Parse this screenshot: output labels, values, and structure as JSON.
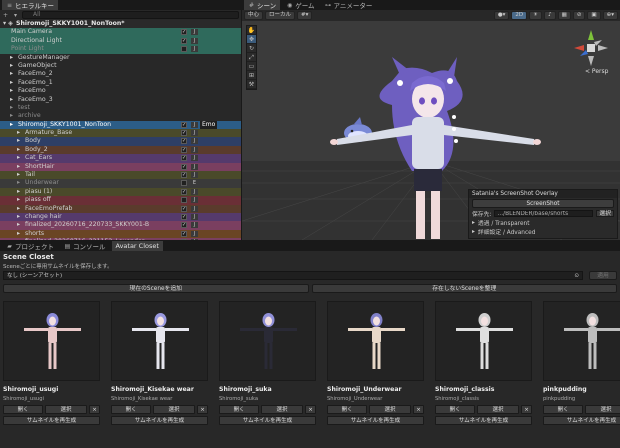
{
  "hierarchy": {
    "tab_label": "ヒエラルキー",
    "search_placeholder": "All",
    "scene_name": "Shiromoji_SKKY1001_NonToon*",
    "items": [
      {
        "label": "Main Camera",
        "indent": 1,
        "style": "teal",
        "check": true,
        "tag": "J"
      },
      {
        "label": "Directional Light",
        "indent": 1,
        "style": "teal",
        "check": true,
        "tag": "J"
      },
      {
        "label": "Point Light",
        "indent": 1,
        "style": "teal dim",
        "check": false,
        "tag": "J"
      },
      {
        "label": "GestureManager",
        "indent": 2,
        "style": "",
        "check": null,
        "tag": ""
      },
      {
        "label": "GameObject",
        "indent": 2,
        "style": "",
        "check": null,
        "tag": ""
      },
      {
        "label": "FaceEmo_2",
        "indent": 2,
        "style": "",
        "check": null,
        "tag": ""
      },
      {
        "label": "FaceEmo_1",
        "indent": 2,
        "style": "",
        "check": null,
        "tag": ""
      },
      {
        "label": "FaceEmo",
        "indent": 2,
        "style": "",
        "check": null,
        "tag": ""
      },
      {
        "label": "FaceEmo_3",
        "indent": 2,
        "style": "",
        "check": null,
        "tag": ""
      },
      {
        "label": "test",
        "indent": 2,
        "style": "dim",
        "check": null,
        "tag": ""
      },
      {
        "label": "archive",
        "indent": 2,
        "style": "dim",
        "check": null,
        "tag": ""
      },
      {
        "label": "Shiromoji_SKKY1001_NonToon",
        "indent": 2,
        "style": "sel",
        "check": true,
        "tag": "J",
        "emo": "Emo"
      },
      {
        "label": "Armature_Base",
        "indent": 3,
        "style": "olive",
        "check": true,
        "tag": "J"
      },
      {
        "label": "Body",
        "indent": 3,
        "style": "blue",
        "check": true,
        "tag": "J"
      },
      {
        "label": "Body_2",
        "indent": 3,
        "style": "brown",
        "check": true,
        "tag": "J"
      },
      {
        "label": "Cat_Ears",
        "indent": 3,
        "style": "purple",
        "check": true,
        "tag": "J"
      },
      {
        "label": "ShortHair",
        "indent": 3,
        "style": "pink",
        "check": true,
        "tag": "J"
      },
      {
        "label": "Tail",
        "indent": 3,
        "style": "olive",
        "check": true,
        "tag": "J"
      },
      {
        "label": "Underwear",
        "indent": 3,
        "style": "gray dim",
        "check": false,
        "tag": "E"
      },
      {
        "label": "piasu (1)",
        "indent": 3,
        "style": "olive",
        "check": true,
        "tag": "J"
      },
      {
        "label": "piass off",
        "indent": 3,
        "style": "red",
        "check": false,
        "tag": "J"
      },
      {
        "label": "FaceEmoPrefab",
        "indent": 3,
        "style": "brown",
        "check": true,
        "tag": "J"
      },
      {
        "label": "change hair",
        "indent": 3,
        "style": "purple",
        "check": true,
        "tag": "J"
      },
      {
        "label": "finalized_20260716_220733_SKKY001-B",
        "indent": 3,
        "style": "pink",
        "check": true,
        "tag": "J"
      },
      {
        "label": "shorts",
        "indent": 3,
        "style": "orange",
        "check": true,
        "tag": "J"
      },
      {
        "label": "finalized_20260716_221152_Lavender",
        "indent": 3,
        "style": "pink",
        "check": true,
        "tag": "J"
      },
      {
        "label": "Same",
        "indent": 3,
        "style": "blue",
        "check": true,
        "tag": "J"
      }
    ]
  },
  "scene": {
    "tabs": [
      "シーン",
      "ゲーム",
      "アニメーター"
    ],
    "toolbar": [
      "中心",
      "ローカル",
      "2D"
    ],
    "persp_label": "< Persp",
    "overlay": {
      "title": "Satania's ScreenShot Overlay",
      "shot_button": "ScreenShot",
      "save_label": "保存先:",
      "save_path": "…/BLENDER/base/shorts",
      "pick_button": "選択",
      "transparent": "透過 / Transparent",
      "advanced": "詳細設定 / Advanced"
    }
  },
  "bottom_tabs": [
    "プロジェクト",
    "コンソール",
    "Avatar Closet"
  ],
  "closet": {
    "title": "Scene Closet",
    "description": "Sceneごとに専用サムネイルを保存します。",
    "dropdown": "なし (シーンアセット)",
    "apply_button": "適用",
    "add_button": "現在のSceneを追加",
    "cleanup_button": "存在しないSceneを整理",
    "open_label": "開く",
    "select_label": "選択",
    "remove_label": "×",
    "regen_label": "サムネイルを再生成",
    "cards": [
      {
        "name": "Shiromoji_usugi",
        "sub": "Shiromoji_usugi",
        "outfit": "#e8c8c8",
        "hair": "#8a8ad8"
      },
      {
        "name": "Shiromoji_Kisekae wear",
        "sub": "Shiromoji_Kisekae wear",
        "outfit": "#e6e6ee",
        "hair": "#9a9ae0"
      },
      {
        "name": "Shiromoji_suka",
        "sub": "Shiromoji_suka",
        "outfit": "#2a2a36",
        "hair": "#9090d8"
      },
      {
        "name": "Shiromoji_Underwear",
        "sub": "Shiromoji_Underwear",
        "outfit": "#e8d8c8",
        "hair": "#8080c8"
      },
      {
        "name": "Shiromoji_classis",
        "sub": "Shiromoji_classis",
        "outfit": "#dedede",
        "hair": "#cfcfcf"
      },
      {
        "name": "pinkpudding",
        "sub": "pinkpudding",
        "outfit": "#bdbdbd",
        "hair": "#bdbdbd"
      }
    ]
  }
}
